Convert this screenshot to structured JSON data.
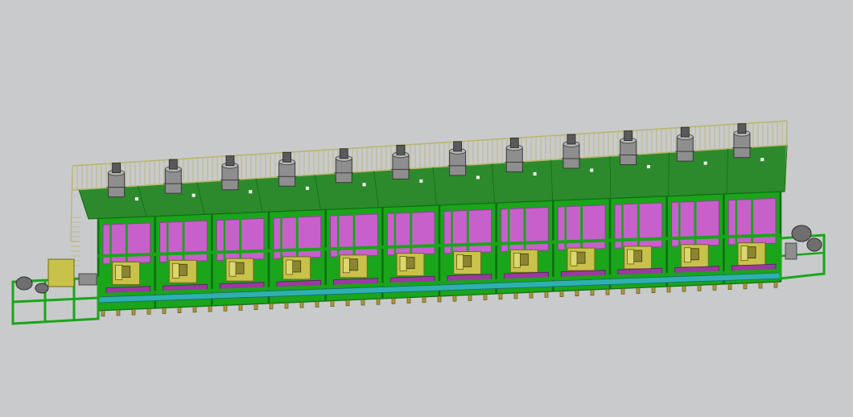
{
  "scene": {
    "kind": "3d-cad-wireframe",
    "subject": "multi-module-production-line",
    "module_count": 12,
    "background_color": "#c9cacc",
    "colors": {
      "frame": "#1aa51a",
      "frame_dark": "#0d6e12",
      "railing": "#b9b56a",
      "top_deck": "#2c8a2c",
      "heater_panel": "#c860cc",
      "heater_panel_dark": "#9a3aa0",
      "drive_unit": "#c8c24a",
      "base_rail": "#2fb0b0",
      "foot": "#a89a3a",
      "motor_body": "#8e8e8e",
      "roller": "#6f6f6f"
    }
  }
}
